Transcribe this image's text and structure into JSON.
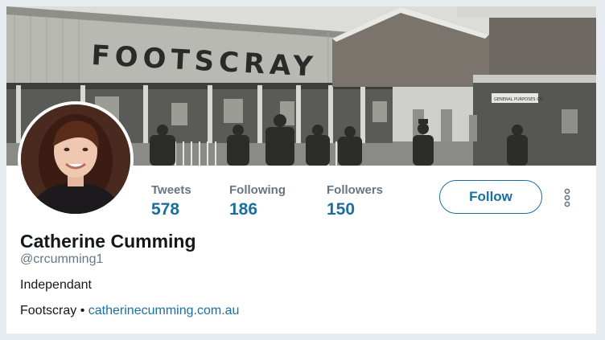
{
  "banner": {
    "sign_text": "FOOTSCRAY",
    "small_sign_text": "GENERAL PURPOSES CO."
  },
  "profile": {
    "name": "Catherine Cumming",
    "handle": "@crcumming1",
    "bio": "Independant",
    "location": "Footscray",
    "separator": "•",
    "website": "catherinecumming.com.au"
  },
  "stats": [
    {
      "label": "Tweets",
      "value": "578"
    },
    {
      "label": "Following",
      "value": "186"
    },
    {
      "label": "Followers",
      "value": "150"
    }
  ],
  "actions": {
    "follow_label": "Follow",
    "more_icon": "vertical-dots-icon"
  },
  "colors": {
    "accent": "#1b6fa0",
    "muted_text": "#657786",
    "primary_text": "#14171a",
    "page_background": "#e6ecf0"
  }
}
